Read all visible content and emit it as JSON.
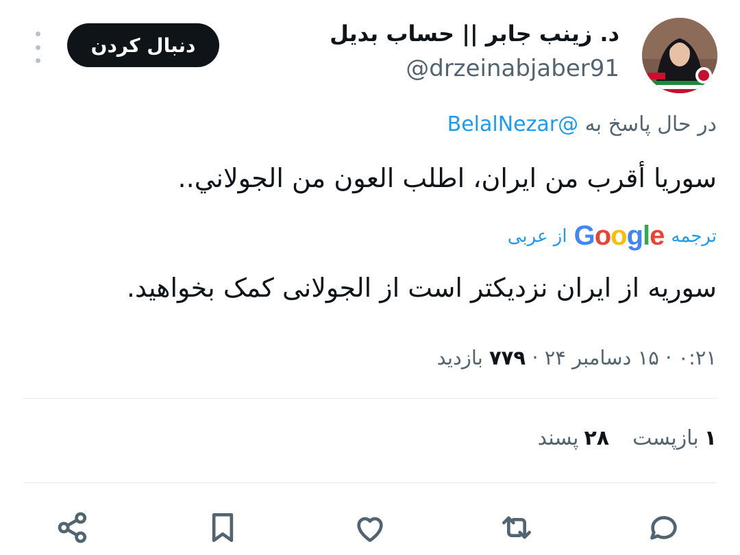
{
  "header": {
    "display_name": "د. زينب جابر || حساب بديل",
    "handle": "@drzeinabjaber91",
    "follow_label": "دنبال کردن"
  },
  "reply": {
    "prefix": "در حال پاسخ به",
    "mention": "@BelalNezar"
  },
  "tweet": {
    "text": "سوريا أقرب من ايران، اطلب العون من الجولاني..",
    "translate_label": "ترجمه",
    "translate_provider": "Google",
    "translate_from": "از عربی",
    "translated_text": "سوریه از ایران نزدیکتر است از الجولانی کمک بخواهید."
  },
  "meta": {
    "time": "۰:۲۱",
    "date": "۱۵ دسامبر ۲۴",
    "views_count": "۷۷۹",
    "views_label": "بازدید",
    "separator": "·"
  },
  "stats": {
    "retweets_count": "۱",
    "retweets_label": "بازپست",
    "likes_count": "۲۸",
    "likes_label": "پسند"
  },
  "actions": {
    "icons": [
      "reply-icon",
      "repost-icon",
      "like-icon",
      "bookmark-icon",
      "share-icon"
    ]
  },
  "colors": {
    "accent": "#1d9bf0",
    "text": "#0f1419",
    "secondary": "#536471",
    "divider": "#e6ebee",
    "google_blue": "#4285f4",
    "google_red": "#ea4335",
    "google_yellow": "#fbbc05",
    "google_green": "#34a853"
  }
}
